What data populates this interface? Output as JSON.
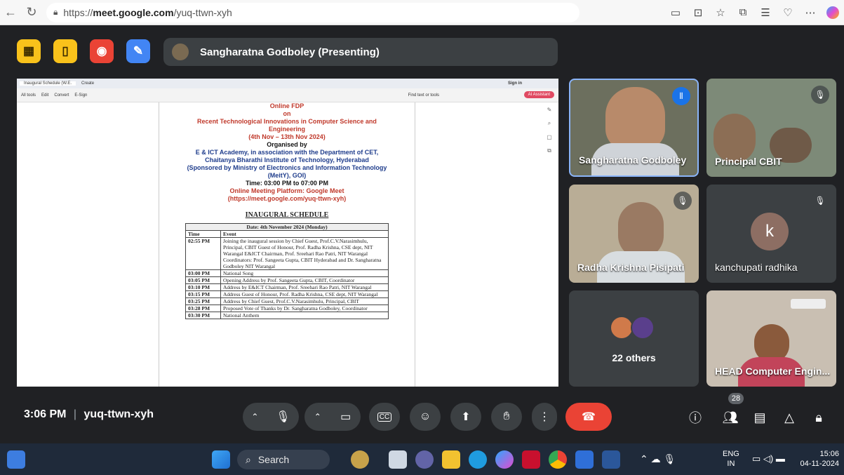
{
  "browser": {
    "url_prefix": "https://",
    "url_domain": "meet.google.com",
    "url_path": "/yuq-ttwn-xyh"
  },
  "top": {
    "presenting_label": "Sangharatna Godboley (Presenting)"
  },
  "shared_doc": {
    "tabs": [
      "Inaugural Schedule (W.E.",
      "Create"
    ],
    "tools": [
      "All tools",
      "Edit",
      "Convert",
      "E-Sign"
    ],
    "toolbar_right": "Find text or tools",
    "ai_label": "AI Assistant",
    "sign_in": "Sign in",
    "line_fdp": "Online FDP",
    "line_on": "on",
    "line_topic": "Recent Technological Innovations in Computer Science and Engineering",
    "line_dates": "(4th Nov – 13th Nov 2024)",
    "line_organised": "Organised by",
    "line_org1": "E & ICT Academy, in association with the Department of CET,",
    "line_org2": "Chaitanya Bharathi Institute of Technology, Hyderabad",
    "line_sponsor": "(Sponsored by Ministry of Electronics and Information Technology (MeitY), GOI)",
    "line_time": "Time: 03:00 PM to 07:00 PM",
    "line_platform": "Online Meeting Platform: Google Meet",
    "line_link": "(https://meet.google.com/yuq-ttwn-xyh)",
    "schedule_title": "INAUGURAL SCHEDULE",
    "date_header": "Date: 4th November 2024 (Monday)",
    "col_time": "Time",
    "col_event": "Event",
    "rows": [
      {
        "time": "02:55 PM",
        "event": "Joining the inaugural session by Chief Guest, Prof.C.V.Narasimhulu, Principal, CBIT Guest of Honour, Prof. Radha Krishna, CSE dept, NIT Warangal E&ICT Chairman, Prof. Sreehari Rao Patri, NIT Warangal Coordinators: Prof. Sangeeta Gupta, CBIT Hyderabad and Dr. Sangharatna Godboley NIT Warangal"
      },
      {
        "time": "03:00 PM",
        "event": "National Song"
      },
      {
        "time": "03:05 PM",
        "event": "Opening Address by Prof. Sangeeta Gupta, CBIT, Coordinator"
      },
      {
        "time": "03:10 PM",
        "event": "Address by E&ICT Chairman, Prof. Sreehari Rao Patri, NIT Warangal"
      },
      {
        "time": "03:15 PM",
        "event": "Address Guest of Honour, Prof. Radha Krishna, CSE dept, NIT Warangal"
      },
      {
        "time": "03:25 PM",
        "event": "Address by Chief Guest, Prof.C.V.Narasimhulu, Principal, CBIT"
      },
      {
        "time": "03:28 PM",
        "event": "Proposed Vote of Thanks by Dr. Sangharatna Godboley, Coordinator"
      },
      {
        "time": "03:30 PM",
        "event": "National Anthem"
      }
    ]
  },
  "tiles": {
    "t1": "Sangharatna Godboley",
    "t2": "Principal CBIT",
    "t3": "Radha Krishna Pisipati",
    "t4": "kanchupati radhika",
    "t4_initial": "k",
    "t5": "22 others",
    "t6": "HEAD Computer Engin..."
  },
  "bottom": {
    "time": "3:06 PM",
    "separator": "|",
    "code": "yuq-ttwn-xyh",
    "people_count": "28"
  },
  "taskbar": {
    "search": "Search",
    "lang1": "ENG",
    "lang2": "IN",
    "clock_time": "15:06",
    "clock_date": "04-11-2024"
  },
  "colors": {
    "meet_bg": "#202124",
    "end_call": "#ea4335",
    "active_border": "#8ab4f8"
  }
}
